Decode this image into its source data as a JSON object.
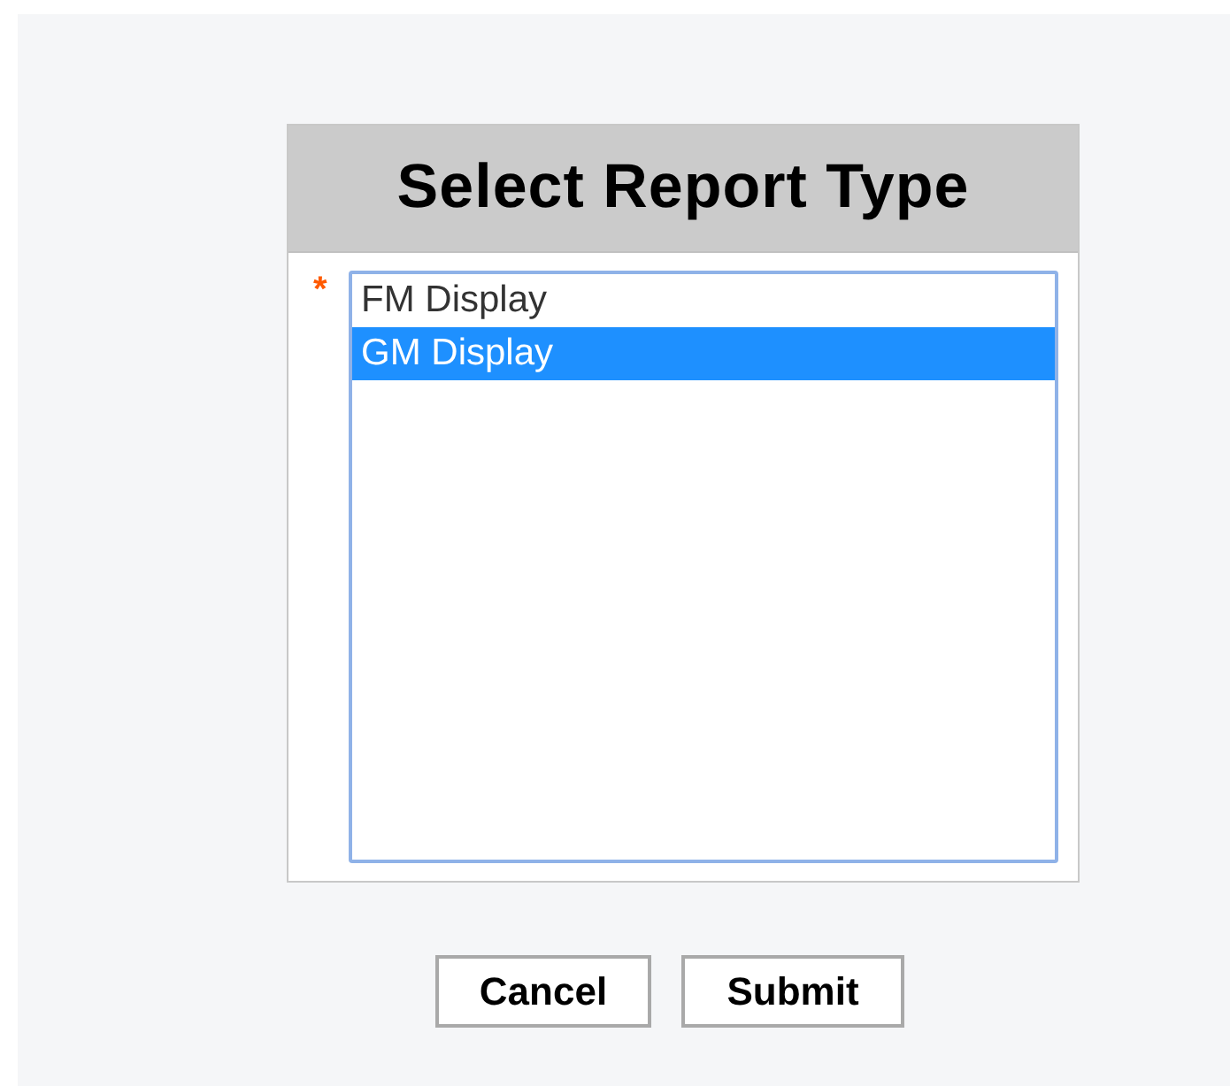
{
  "dialog": {
    "title": "Select Report Type",
    "required_mark": "*",
    "options": [
      {
        "label": "FM Display",
        "selected": false
      },
      {
        "label": "GM Display",
        "selected": true
      }
    ]
  },
  "buttons": [
    "Cancel",
    "Submit"
  ]
}
